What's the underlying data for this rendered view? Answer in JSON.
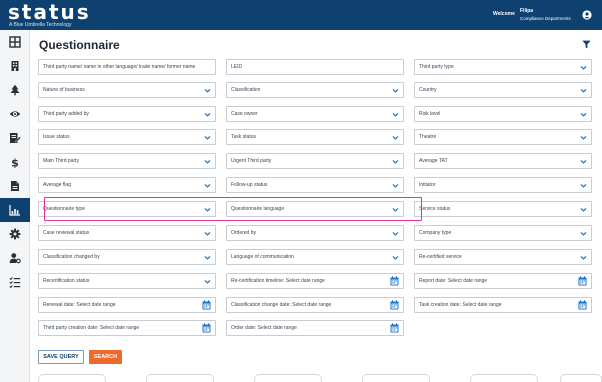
{
  "header": {
    "logo_text": "status",
    "logo_tagline": "A Blue Umbrella Technology",
    "welcome_label": "Welcome",
    "user_name": "Filipa",
    "user_department": "Compliance Departments"
  },
  "sidebar": {
    "items": [
      {
        "icon": "dashboard-grid-icon",
        "active": false
      },
      {
        "icon": "building-icon",
        "active": false
      },
      {
        "icon": "tree-icon",
        "active": false
      },
      {
        "icon": "eye-icon",
        "active": false
      },
      {
        "icon": "edit-document-icon",
        "active": false
      },
      {
        "icon": "dollar-icon",
        "active": false
      },
      {
        "icon": "document-icon",
        "active": false
      },
      {
        "icon": "analytics-chart-icon",
        "active": true
      },
      {
        "icon": "gear-icon",
        "active": false
      },
      {
        "icon": "user-settings-icon",
        "active": false
      },
      {
        "icon": "list-check-icon",
        "active": false
      }
    ]
  },
  "page": {
    "title": "Questionnaire"
  },
  "fields": {
    "third_party_name": "Third party name/ name in other language/ trade name/ former name",
    "leid": "LEID",
    "third_party_type": "Third party type",
    "nature_of_business": "Nature of business",
    "classification": "Classification",
    "country": "Country",
    "third_party_added_by": "Third party added by",
    "case_owner": "Case owner",
    "risk_level": "Risk level",
    "issue_status": "Issue status",
    "task_status": "Task status",
    "theatre": "Theatre",
    "main_third_party": "Main Third party",
    "urgent_third_party": "Urgent Third party",
    "average_tat": "Average TAT",
    "average_flag": "Average flag",
    "follow_up_status": "Follow-up status",
    "initiator": "Initiator",
    "questionnaire_type": "Questionnaire type",
    "questionnaire_language": "Questionnaire language",
    "service_status": "Service status",
    "case_reviewal_status": "Case reviewal status",
    "ordered_by": "Ordered by",
    "company_type": "Company type",
    "classification_changed_by": "Classification changed by",
    "language_of_communication": "Language of communication",
    "re_certified_service": "Re-certified service",
    "recertification_status": "Recertification status",
    "recert_timeline_date": "Re-certification timeline: Select date range",
    "report_date": "Report date: Select date range",
    "renewal_date": "Renewal date: Select date range",
    "classification_change_date": "Classification change date: Select date range",
    "task_creation_date": "Task creation date: Select date range",
    "third_party_creation_date": "Third party creation date: Select date range",
    "order_date": "Order date: Select date range"
  },
  "actions": {
    "save_query": "SAVE QUERY",
    "search": "SEARCH"
  },
  "colors": {
    "header_bg": "#0e4170",
    "accent_blue": "#1a73c8",
    "search_orange": "#ef6a2a",
    "highlight_pink": "#e0309a"
  }
}
